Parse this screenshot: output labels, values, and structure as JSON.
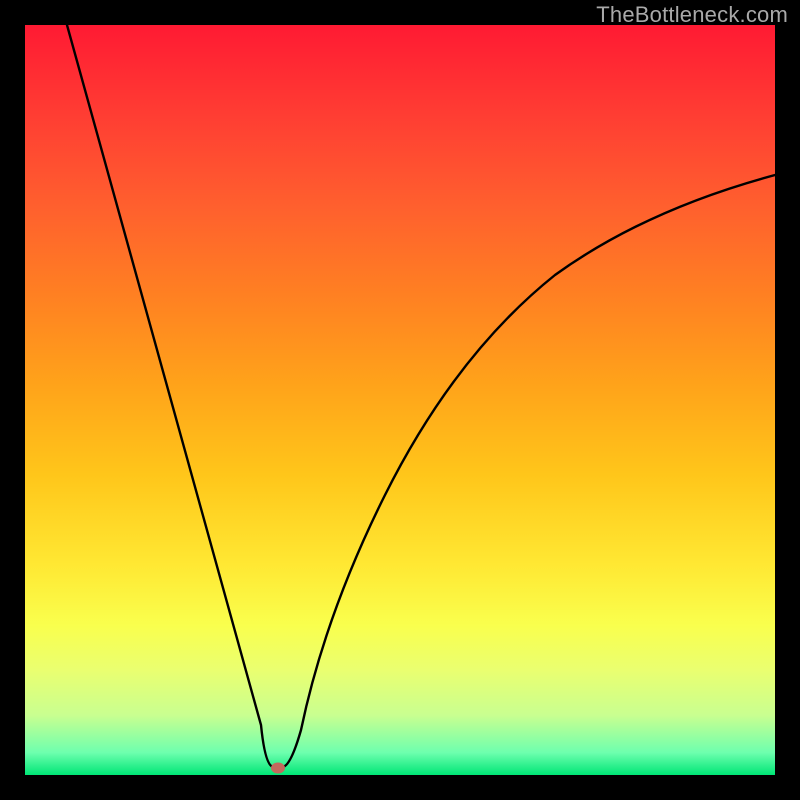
{
  "watermark": {
    "text": "TheBottleneck.com"
  },
  "dot": {
    "x_pct": 33.8,
    "y_pct": 99.1
  },
  "chart_data": {
    "type": "line",
    "title": "",
    "xlabel": "",
    "ylabel": "",
    "xlim": [
      0,
      100
    ],
    "ylim": [
      0,
      100
    ],
    "grid": false,
    "legend": false,
    "background": "red-yellow-green vertical gradient (high=red at top, low=green at bottom)",
    "series": [
      {
        "name": "bottleneck-curve",
        "x": [
          0,
          5,
          10,
          15,
          20,
          25,
          28,
          30,
          32,
          33,
          34,
          35,
          37,
          40,
          45,
          50,
          55,
          60,
          65,
          70,
          75,
          80,
          85,
          90,
          95,
          100
        ],
        "y": [
          100,
          85,
          70,
          55,
          40,
          24,
          14,
          8,
          3,
          1,
          1,
          2,
          5,
          13,
          26,
          36,
          44,
          50,
          55,
          59,
          62,
          65,
          67,
          69,
          71,
          72
        ]
      }
    ],
    "marker": {
      "x": 33.8,
      "y": 0.9,
      "color": "#c36a5d"
    }
  }
}
